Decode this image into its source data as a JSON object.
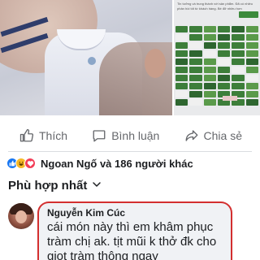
{
  "post": {
    "side_photo_text": "Tin tưởng và trung thành với sản phẩm. Đã có nhiều phản hồi tốt từ khách hàng. Bé đỡ nhiều hơn"
  },
  "actions": {
    "like_label": "Thích",
    "comment_label": "Bình luận",
    "share_label": "Chia sẻ"
  },
  "reactions": {
    "name": "Ngoan Ngố",
    "rest": " và 186 người khác",
    "emojis": [
      "like-icon",
      "haha-icon",
      "love-icon"
    ]
  },
  "sort": {
    "label": "Phù hợp nhất"
  },
  "comment": {
    "author": "Nguyễn Kim Cúc",
    "text": "cái món này thì em khâm phục tràm chị ak. tịt mũi k thở đk cho giọt tràm thông ngay"
  },
  "colors": {
    "brand_blue": "#1877f2",
    "highlight_border": "#d32f2f",
    "action_gray": "#65676b",
    "bubble_bg": "#f0f2f5"
  }
}
